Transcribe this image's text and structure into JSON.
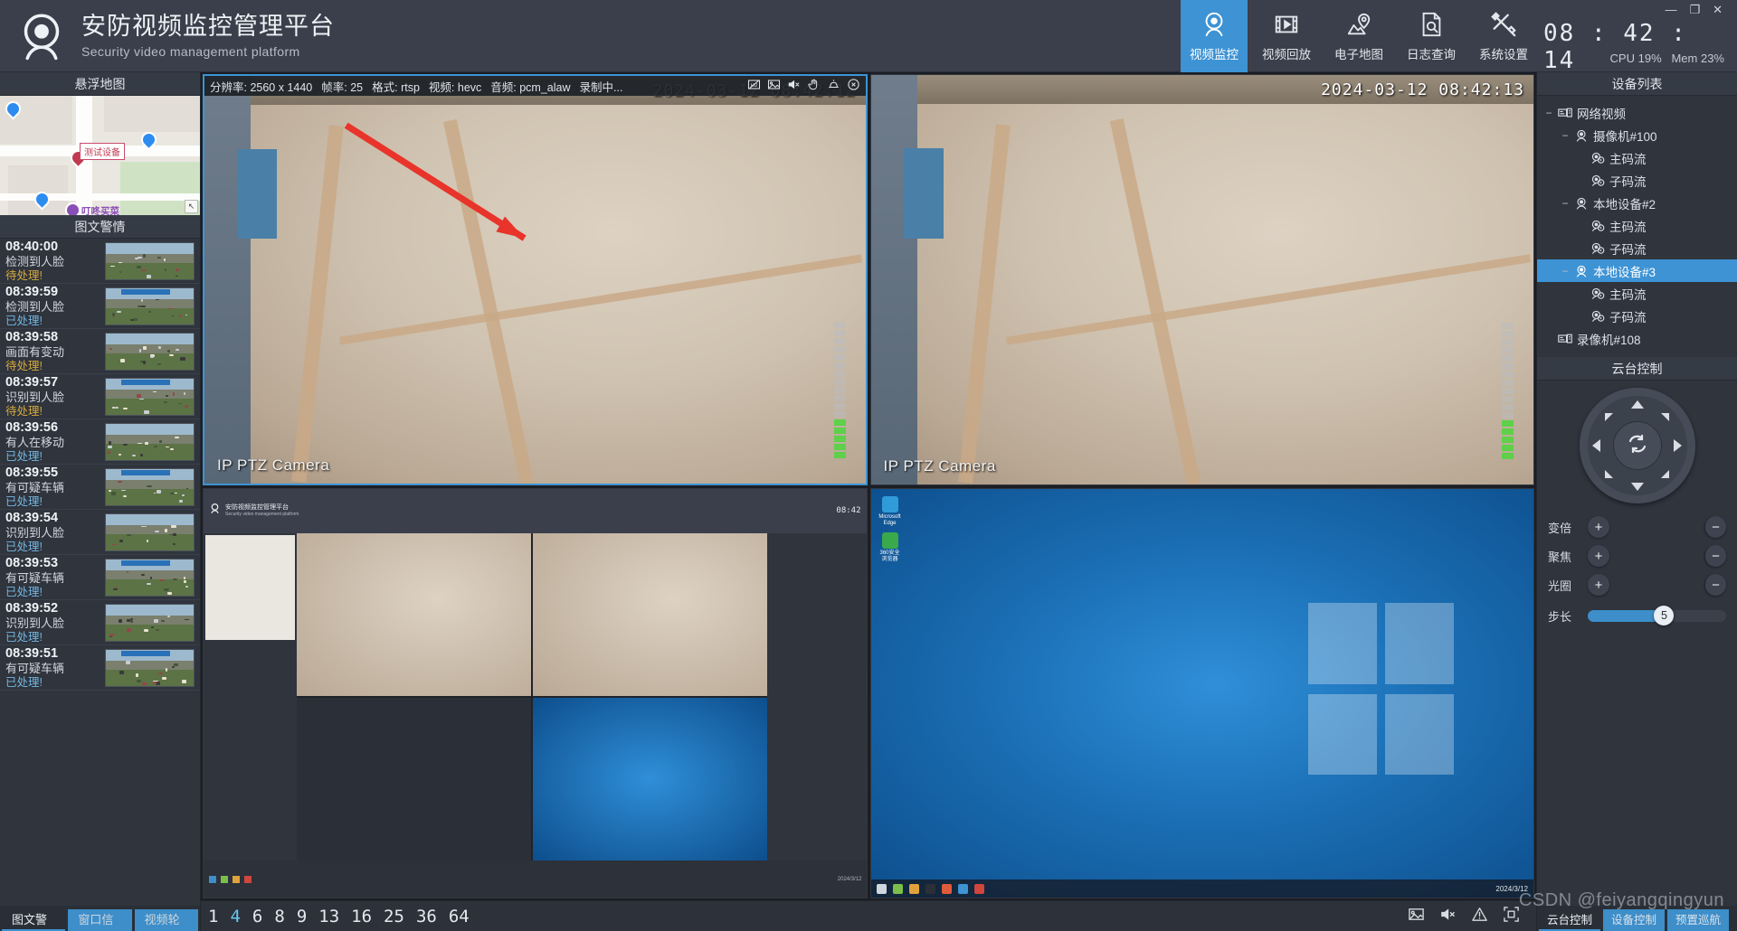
{
  "header": {
    "title_cn": "安防视频监控管理平台",
    "title_en": "Security video management platform",
    "logo_icon": "camera-dome-icon",
    "nav": [
      {
        "label": "视频监控",
        "icon": "camera-dome-icon",
        "active": true
      },
      {
        "label": "视频回放",
        "icon": "film-play-icon",
        "active": false
      },
      {
        "label": "电子地图",
        "icon": "map-pin-icon",
        "active": false
      },
      {
        "label": "日志查询",
        "icon": "document-search-icon",
        "active": false
      },
      {
        "label": "系统设置",
        "icon": "tools-icon",
        "active": false
      }
    ],
    "window_buttons": {
      "minimize": "—",
      "maximize": "❐",
      "close": "✕"
    },
    "clock": "08 : 42 : 14",
    "cpu": "CPU 19%",
    "mem": "Mem 23%"
  },
  "left_panel": {
    "map_title": "悬浮地图",
    "map": {
      "label_device": "测试设备",
      "label_shop": "叮咚买菜",
      "corner_icon": "collapse-arrow-icon"
    },
    "alarm_title": "图文警情",
    "alarms": [
      {
        "time": "08:40:00",
        "event": "检测到人脸",
        "status": "待处理!",
        "state": "pending"
      },
      {
        "time": "08:39:59",
        "event": "检测到人脸",
        "status": "已处理!",
        "state": "done"
      },
      {
        "time": "08:39:58",
        "event": "画面有变动",
        "status": "待处理!",
        "state": "pending"
      },
      {
        "time": "08:39:57",
        "event": "识别到人脸",
        "status": "待处理!",
        "state": "pending"
      },
      {
        "time": "08:39:56",
        "event": "有人在移动",
        "status": "已处理!",
        "state": "done"
      },
      {
        "time": "08:39:55",
        "event": "有可疑车辆",
        "status": "已处理!",
        "state": "done"
      },
      {
        "time": "08:39:54",
        "event": "识别到人脸",
        "status": "已处理!",
        "state": "done"
      },
      {
        "time": "08:39:53",
        "event": "有可疑车辆",
        "status": "已处理!",
        "state": "done"
      },
      {
        "time": "08:39:52",
        "event": "识别到人脸",
        "status": "已处理!",
        "state": "done"
      },
      {
        "time": "08:39:51",
        "event": "有可疑车辆",
        "status": "已处理!",
        "state": "done"
      }
    ],
    "tabs": [
      {
        "label": "图文警情",
        "active": true
      },
      {
        "label": "窗口信息",
        "active": false
      },
      {
        "label": "视频轮询",
        "active": false
      }
    ]
  },
  "video": {
    "stream_info": {
      "resolution": "分辨率: 2560 x 1440",
      "framerate": "帧率: 25",
      "format": "格式: rtsp",
      "video_codec": "视频: hevc",
      "audio_codec": "音频: pcm_alaw",
      "recording": "录制中..."
    },
    "info_icons": [
      "hd-off-icon",
      "snapshot-icon",
      "mute-icon",
      "drag-hand-icon",
      "alarm-bell-icon",
      "close-circle-icon"
    ],
    "cells": [
      {
        "name": "IP PTZ Camera",
        "timestamp": "2024-03-12 08:42:12",
        "selected": true,
        "kind": "tile"
      },
      {
        "name": "IP PTZ Camera",
        "timestamp": "2024-03-12 08:42:13",
        "selected": false,
        "kind": "tile"
      },
      {
        "name": "",
        "timestamp": "",
        "selected": false,
        "kind": "nested"
      },
      {
        "name": "",
        "timestamp": "",
        "selected": false,
        "kind": "desktop"
      }
    ],
    "nested_desktop": {
      "title_cn": "安防视频监控管理平台",
      "title_en": "Security video management platform",
      "clock": "08:42",
      "taskbar_date": "2024/3/12"
    },
    "desktop": {
      "icon1": "Microsoft Edge",
      "icon2": "360安全浏览器",
      "taskbar_date": "2024/3/12"
    }
  },
  "status_bar": {
    "layouts": [
      {
        "label": "1",
        "active": false
      },
      {
        "label": "4",
        "active": true
      },
      {
        "label": "6",
        "active": false
      },
      {
        "label": "8",
        "active": false
      },
      {
        "label": "9",
        "active": false
      },
      {
        "label": "13",
        "active": false
      },
      {
        "label": "16",
        "active": false
      },
      {
        "label": "25",
        "active": false
      },
      {
        "label": "36",
        "active": false
      },
      {
        "label": "64",
        "active": false
      }
    ],
    "icons": [
      "snapshot-icon",
      "mute-icon",
      "warning-icon",
      "fullscreen-icon"
    ]
  },
  "right_panel": {
    "device_title": "设备列表",
    "tree": [
      {
        "label": "网络视频",
        "depth": 0,
        "icon": "nvr-icon",
        "toggle": "−",
        "selected": false
      },
      {
        "label": "摄像机#100",
        "depth": 1,
        "icon": "camera-icon",
        "toggle": "−",
        "selected": false
      },
      {
        "label": "主码流",
        "depth": 2,
        "icon": "stream-icon",
        "toggle": "",
        "selected": false
      },
      {
        "label": "子码流",
        "depth": 2,
        "icon": "stream-icon",
        "toggle": "",
        "selected": false
      },
      {
        "label": "本地设备#2",
        "depth": 1,
        "icon": "camera-icon",
        "toggle": "−",
        "selected": false
      },
      {
        "label": "主码流",
        "depth": 2,
        "icon": "stream-icon",
        "toggle": "",
        "selected": false
      },
      {
        "label": "子码流",
        "depth": 2,
        "icon": "stream-icon",
        "toggle": "",
        "selected": false
      },
      {
        "label": "本地设备#3",
        "depth": 1,
        "icon": "camera-icon",
        "toggle": "−",
        "selected": true
      },
      {
        "label": "主码流",
        "depth": 2,
        "icon": "stream-icon",
        "toggle": "",
        "selected": false
      },
      {
        "label": "子码流",
        "depth": 2,
        "icon": "stream-icon",
        "toggle": "",
        "selected": false
      },
      {
        "label": "录像机#108",
        "depth": 0,
        "icon": "nvr-icon",
        "toggle": "",
        "selected": false
      }
    ],
    "ptz_title": "云台控制",
    "ptz_center_icon": "auto-rotate-icon",
    "controls": [
      {
        "label": "变倍",
        "plus": "+",
        "minus": "−"
      },
      {
        "label": "聚焦",
        "plus": "+",
        "minus": "−"
      },
      {
        "label": "光圈",
        "plus": "+",
        "minus": "−"
      }
    ],
    "step_label": "步长",
    "step_value": "5",
    "tabs": [
      {
        "label": "云台控制",
        "active": true
      },
      {
        "label": "设备控制",
        "active": false
      },
      {
        "label": "预置巡航",
        "active": false
      }
    ]
  },
  "watermark": "CSDN @feiyangqingyun",
  "colors": {
    "accent": "#3d93d4",
    "panel": "#2f343d",
    "header": "#3a3f4b",
    "pending": "#d6a93c",
    "done": "#74b6e0"
  }
}
